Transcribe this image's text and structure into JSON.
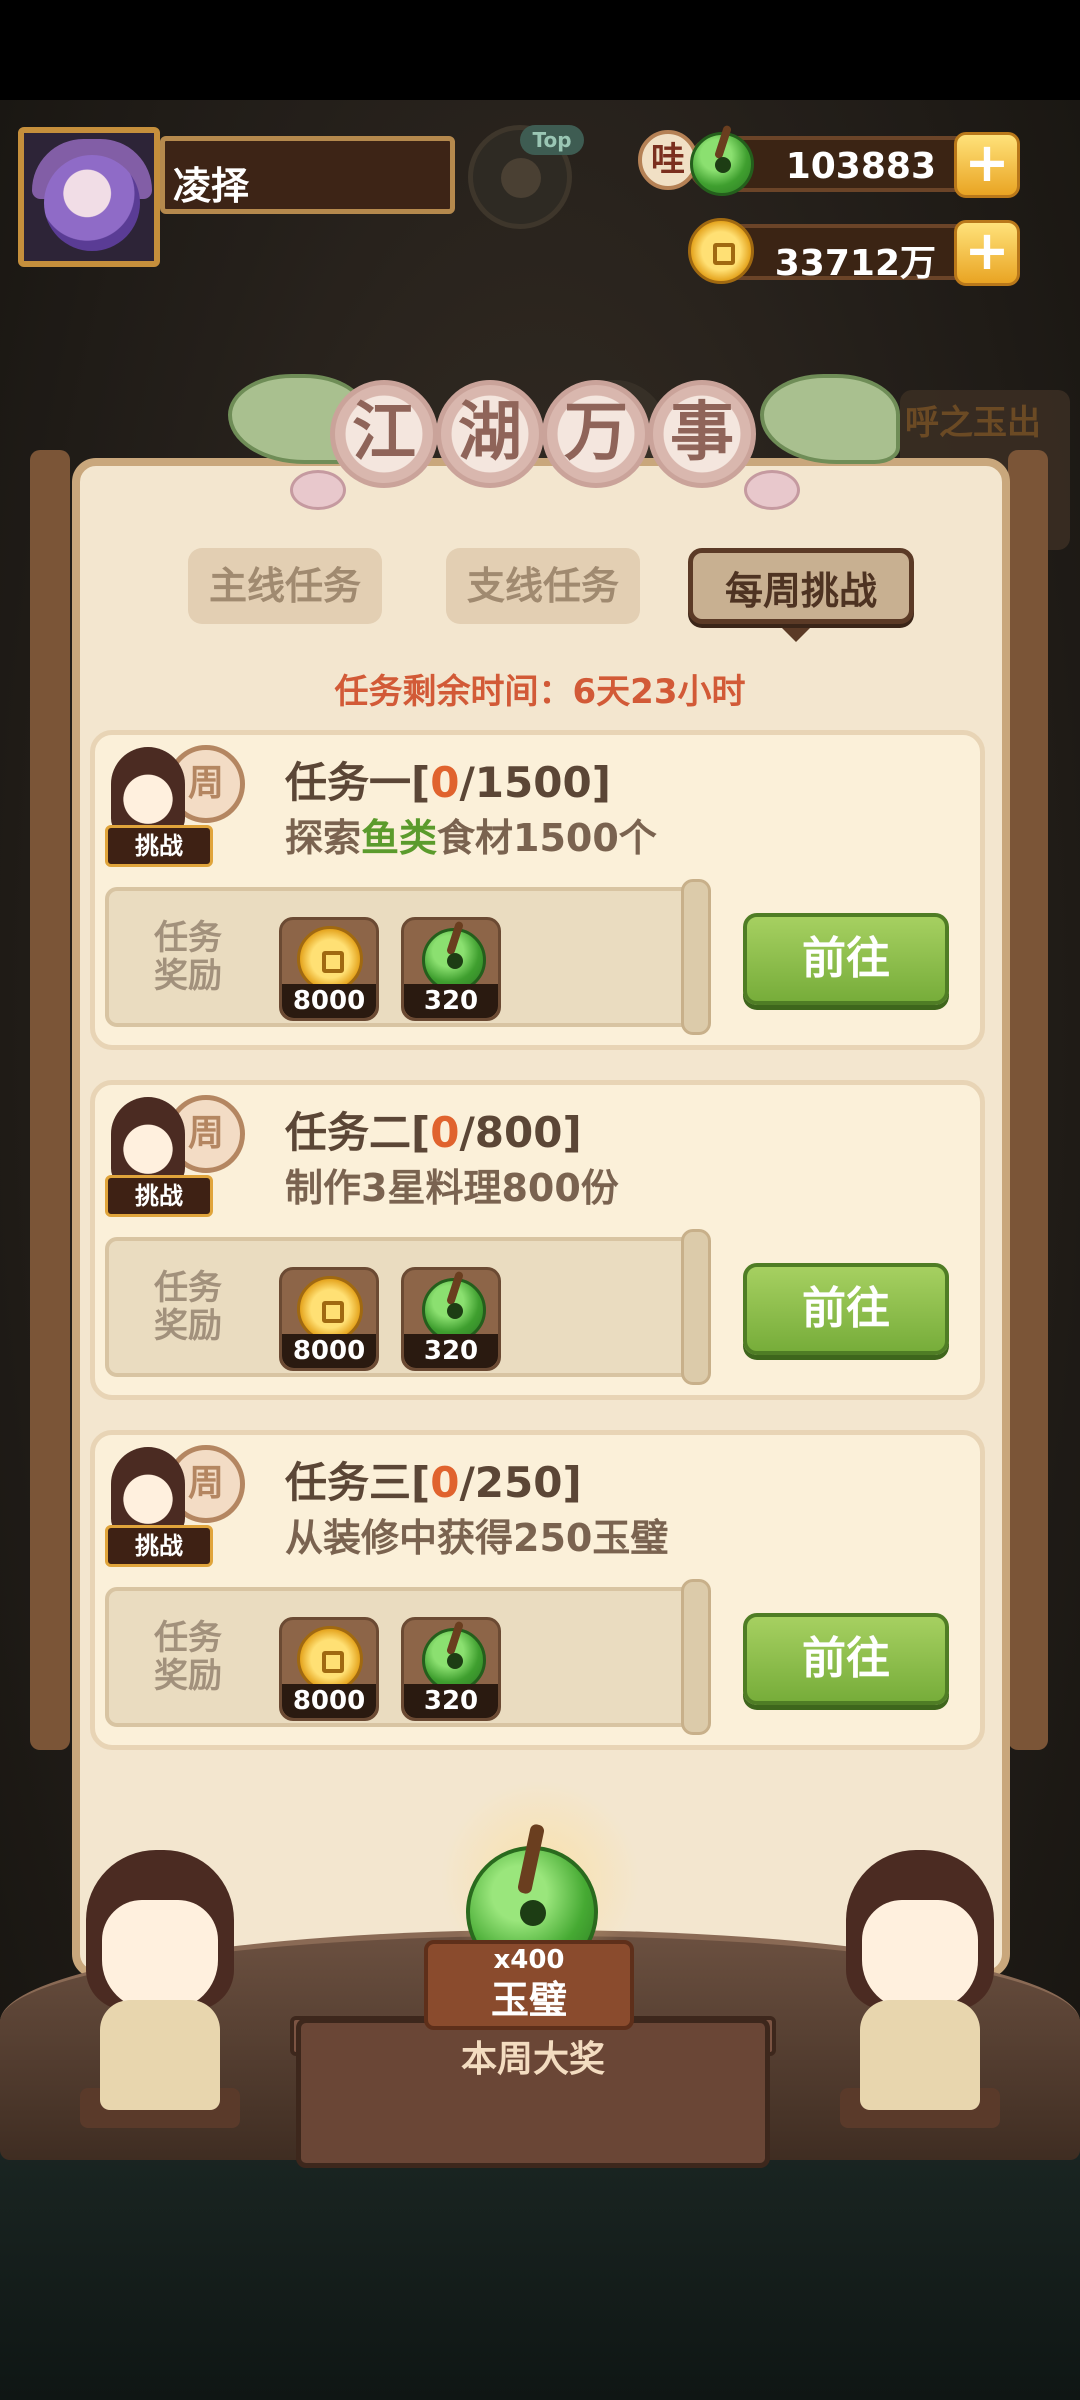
{
  "profile": {
    "name": "凌择"
  },
  "friend": {
    "badge": "Top"
  },
  "currency": {
    "jade": {
      "prefix": "哇",
      "value": "103883",
      "plus": "+"
    },
    "gold": {
      "value": "33712万",
      "plus": "+"
    }
  },
  "background": {
    "sign_text": "呼之玉出"
  },
  "title": {
    "chars": [
      "江",
      "湖",
      "万",
      "事"
    ]
  },
  "tabs": [
    {
      "label": "主线任务",
      "active": false
    },
    {
      "label": "支线任务",
      "active": false
    },
    {
      "label": "每周挑战",
      "active": true
    }
  ],
  "timer": {
    "label": "任务剩余时间：",
    "value": "6天23小时"
  },
  "badge": {
    "plate": "周",
    "tag": "挑战"
  },
  "reward_label_line1": "任务",
  "reward_label_line2": "奖励",
  "go_label": "前往",
  "tasks": [
    {
      "name": "任务一",
      "progress_current": "0",
      "progress_total": "/1500",
      "desc_pre": "探索",
      "desc_hl": "鱼类",
      "desc_post": "食材1500个",
      "rewards": [
        {
          "icon": "gold-coin-icon",
          "amount": "8000"
        },
        {
          "icon": "jade-coin-icon",
          "amount": "320"
        }
      ]
    },
    {
      "name": "任务二",
      "progress_current": "0",
      "progress_total": "/800",
      "desc_pre": "制作3星料理800份",
      "desc_hl": "",
      "desc_post": "",
      "rewards": [
        {
          "icon": "gold-coin-icon",
          "amount": "8000"
        },
        {
          "icon": "jade-coin-icon",
          "amount": "320"
        }
      ]
    },
    {
      "name": "任务三",
      "progress_current": "0",
      "progress_total": "/250",
      "desc_pre": "从装修中获得250玉璧",
      "desc_hl": "",
      "desc_post": "",
      "rewards": [
        {
          "icon": "gold-coin-icon",
          "amount": "8000"
        },
        {
          "icon": "jade-coin-icon",
          "amount": "320"
        }
      ]
    }
  ],
  "grand_prize": {
    "quantity": "x400",
    "name": "玉璧",
    "label": "本周大奖",
    "icon": "jade-coin-icon"
  },
  "colors": {
    "accent_green": "#77ad3a",
    "timer_red": "#d25a37",
    "progress_orange": "#e0632e",
    "highlight_green": "#5b9b2c"
  }
}
